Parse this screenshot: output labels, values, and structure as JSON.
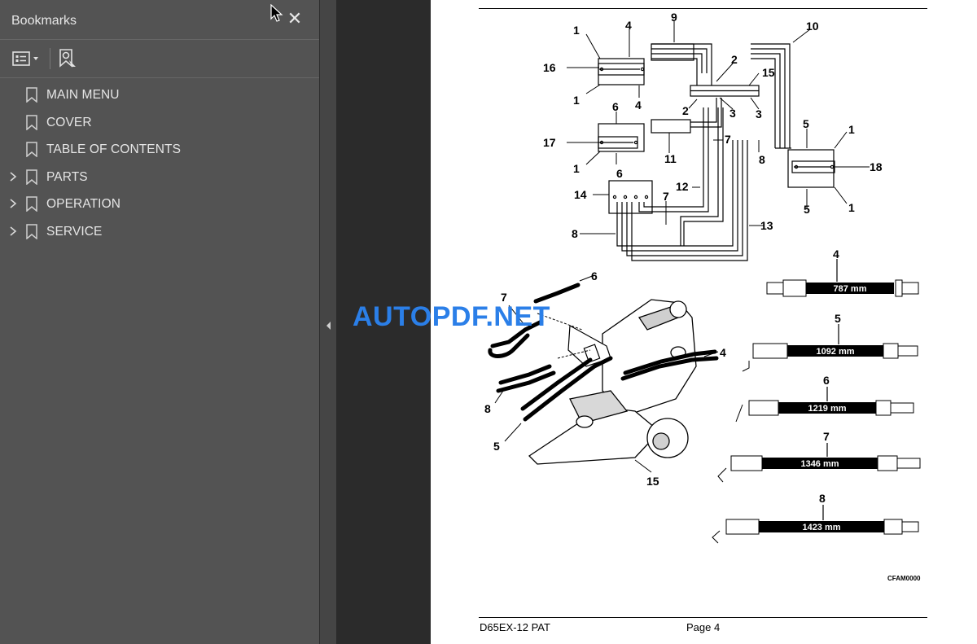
{
  "sidebar": {
    "title": "Bookmarks",
    "close_icon": "close-icon",
    "toolbar": {
      "options_icon": "list-options-icon",
      "find_bookmark_icon": "bookmark-search-icon"
    },
    "items": [
      {
        "label": "MAIN MENU",
        "expandable": false
      },
      {
        "label": "COVER",
        "expandable": false
      },
      {
        "label": "TABLE OF CONTENTS",
        "expandable": false
      },
      {
        "label": "PARTS",
        "expandable": true
      },
      {
        "label": "OPERATION",
        "expandable": true
      },
      {
        "label": "SERVICE",
        "expandable": true
      }
    ]
  },
  "document": {
    "footer_model": "D65EX-12 PAT",
    "footer_page": "Page 4",
    "figure_code": "CFAM0000",
    "watermark": "AUTOPDF.NET",
    "schematic_callouts": [
      "1",
      "4",
      "9",
      "10",
      "16",
      "2",
      "15",
      "1",
      "4",
      "2",
      "3",
      "3",
      "6",
      "5",
      "1",
      "17",
      "7",
      "8",
      "18",
      "1",
      "11",
      "6",
      "14",
      "7",
      "12",
      "5",
      "1",
      "8",
      "13"
    ],
    "hoses": [
      {
        "number": "4",
        "length": "787 mm"
      },
      {
        "number": "5",
        "length": "1092 mm"
      },
      {
        "number": "6",
        "length": "1219 mm"
      },
      {
        "number": "7",
        "length": "1346 mm"
      },
      {
        "number": "8",
        "length": "1423 mm"
      }
    ],
    "illustration_callouts": [
      "6",
      "7",
      "4",
      "8",
      "5",
      "15"
    ]
  }
}
